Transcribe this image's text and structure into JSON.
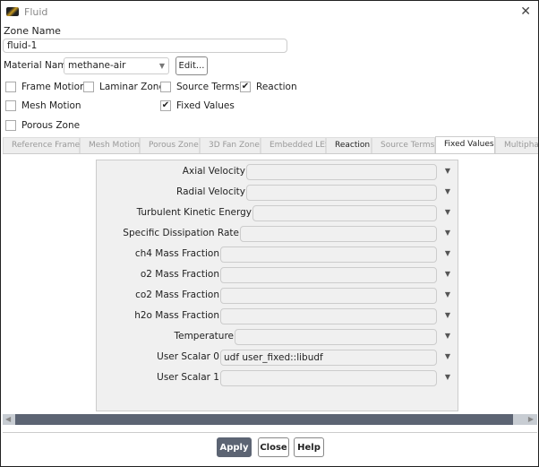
{
  "window": {
    "title": "Fluid",
    "close_icon": "close-icon"
  },
  "zone_name": {
    "label": "Zone Name",
    "value": "fluid-1"
  },
  "material": {
    "label": "Material Name",
    "value": "methane-air",
    "edit_label": "Edit..."
  },
  "checkboxes": [
    {
      "label": "Frame Motion",
      "checked": false
    },
    {
      "label": "Laminar Zone",
      "checked": false
    },
    {
      "label": "Source Terms",
      "checked": false
    },
    {
      "label": "Reaction",
      "checked": true
    },
    {
      "label": "Mesh Motion",
      "checked": false
    },
    {
      "label": "Fixed Values",
      "checked": true
    },
    {
      "label": "Porous Zone",
      "checked": false
    }
  ],
  "tabs": [
    {
      "label": "Reference Frame"
    },
    {
      "label": "Mesh Motion"
    },
    {
      "label": "Porous Zone"
    },
    {
      "label": "3D Fan Zone"
    },
    {
      "label": "Embedded LES"
    },
    {
      "label": "Reaction"
    },
    {
      "label": "Source Terms"
    },
    {
      "label": "Fixed Values",
      "active": true
    },
    {
      "label": "Multiphase"
    }
  ],
  "fixed_values": [
    {
      "label": "Axial Velocity",
      "value": ""
    },
    {
      "label": "Radial Velocity",
      "value": ""
    },
    {
      "label": "Turbulent Kinetic Energy",
      "value": ""
    },
    {
      "label": "Specific Dissipation Rate",
      "value": ""
    },
    {
      "label": "ch4 Mass Fraction",
      "value": ""
    },
    {
      "label": "o2 Mass Fraction",
      "value": ""
    },
    {
      "label": "co2 Mass Fraction",
      "value": ""
    },
    {
      "label": "h2o Mass Fraction",
      "value": ""
    },
    {
      "label": "Temperature",
      "value": ""
    },
    {
      "label": "User Scalar 0",
      "value": "udf user_fixed::libudf"
    },
    {
      "label": "User Scalar 1",
      "value": ""
    }
  ],
  "buttons": {
    "apply": "Apply",
    "close": "Close",
    "help": "Help"
  },
  "colors": {
    "apply_bg": "#5c6473",
    "scroll_thumb": "#5c6473"
  }
}
